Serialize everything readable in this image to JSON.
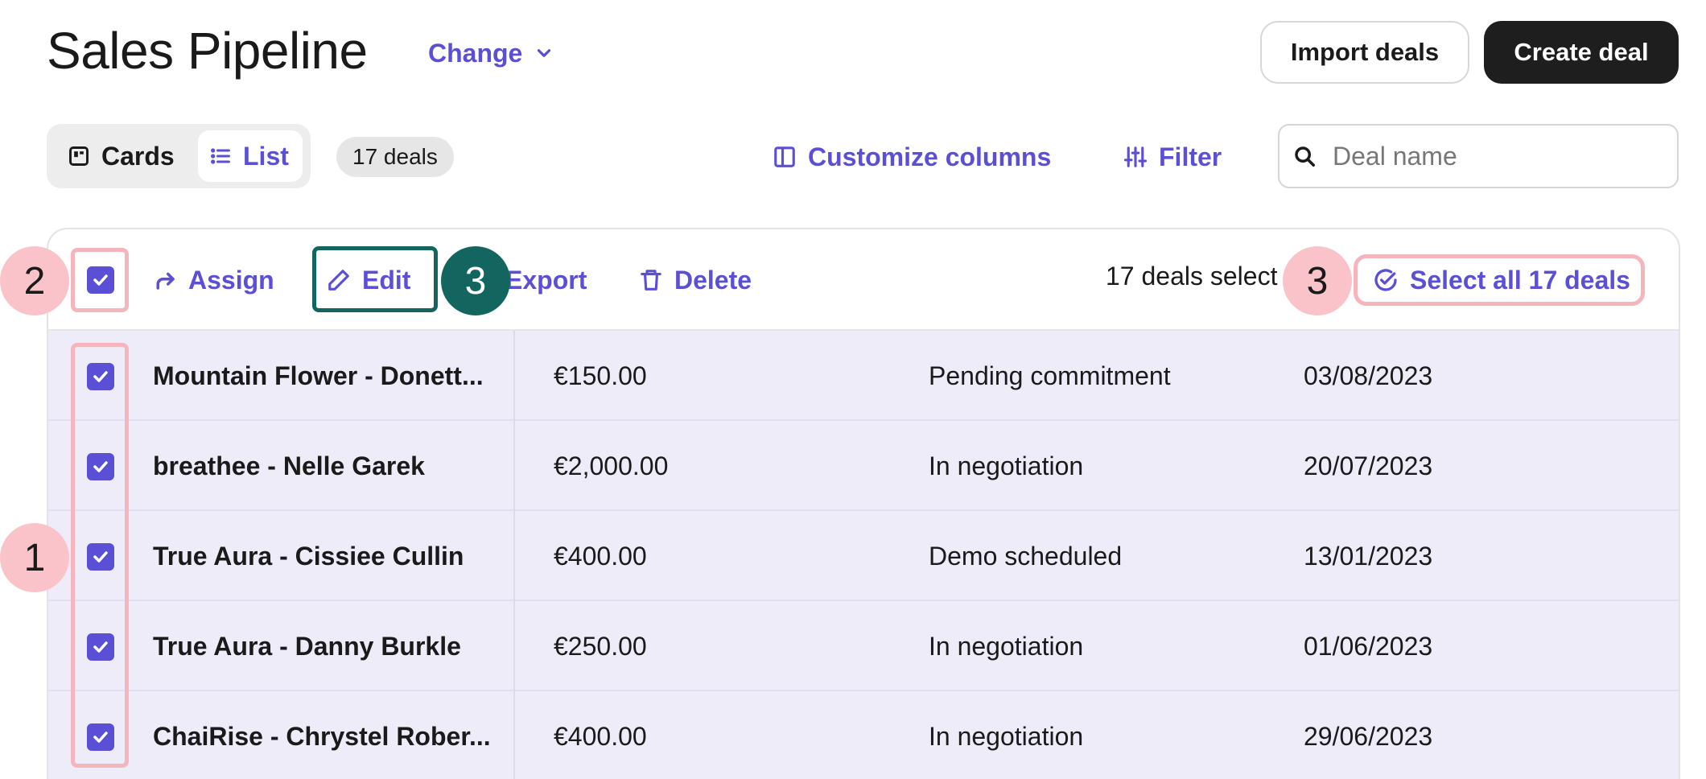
{
  "header": {
    "title": "Sales Pipeline",
    "change_label": "Change",
    "import_label": "Import deals",
    "create_label": "Create deal"
  },
  "toolbar": {
    "view_cards": "Cards",
    "view_list": "List",
    "deal_count": "17 deals",
    "customize_label": "Customize columns",
    "filter_label": "Filter",
    "search_placeholder": "Deal name"
  },
  "actions": {
    "assign": "Assign",
    "edit": "Edit",
    "export": "Export",
    "delete": "Delete",
    "selected_text": "17 deals select",
    "select_all": "Select all 17 deals"
  },
  "rows": [
    {
      "name": "Mountain Flower - Donett...",
      "amount": "€150.00",
      "stage": "Pending commitment",
      "date": "03/08/2023"
    },
    {
      "name": "breathee - Nelle Garek",
      "amount": "€2,000.00",
      "stage": "In negotiation",
      "date": "20/07/2023"
    },
    {
      "name": "True Aura - Cissiee Cullin",
      "amount": "€400.00",
      "stage": "Demo scheduled",
      "date": "13/01/2023"
    },
    {
      "name": "True Aura - Danny Burkle",
      "amount": "€250.00",
      "stage": "In negotiation",
      "date": "01/06/2023"
    },
    {
      "name": "ChaiRise - Chrystel Rober...",
      "amount": "€400.00",
      "stage": "In negotiation",
      "date": "29/06/2023"
    }
  ],
  "annotations": {
    "one": "1",
    "two": "2",
    "three_a": "3",
    "three_b": "3"
  },
  "colors": {
    "accent": "#5b4fd6",
    "row_selected": "#edecf8",
    "highlight_pink": "#f6b4bd",
    "highlight_teal": "#12665f"
  },
  "icons": {
    "change": "chevron-down-icon",
    "cards": "cards-icon",
    "list": "list-icon",
    "customize": "columns-icon",
    "filter": "sliders-icon",
    "search": "search-icon",
    "assign": "forward-arrow-icon",
    "edit": "pencil-icon",
    "delete": "trash-icon",
    "select_all": "check-circle-icon"
  }
}
